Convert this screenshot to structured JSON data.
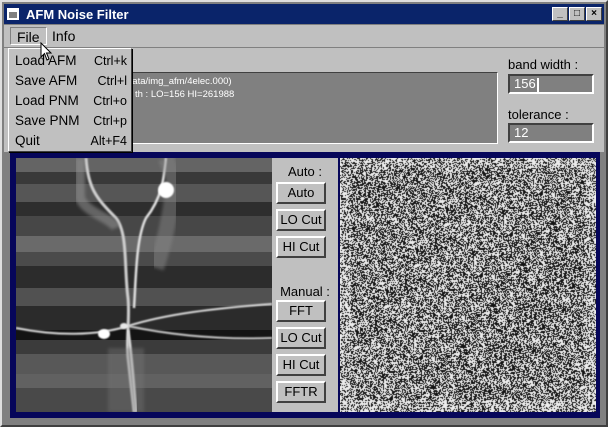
{
  "window": {
    "title": "AFM Noise Filter",
    "buttons": {
      "minimize": "_",
      "maximize": "□",
      "close": "×"
    }
  },
  "menubar": {
    "items": [
      "File",
      "Info"
    ]
  },
  "file_menu": {
    "items": [
      {
        "label": "Load AFM",
        "shortcut": "Ctrl+k"
      },
      {
        "label": "Save AFM",
        "shortcut": "Ctrl+l"
      },
      {
        "label": "Load PNM",
        "shortcut": "Ctrl+o"
      },
      {
        "label": "Save PNM",
        "shortcut": "Ctrl+p"
      },
      {
        "label": "Quit",
        "shortcut": "Alt+F4"
      }
    ]
  },
  "log": {
    "lines": [
      "data/img_afm/4elec.000)",
      "th : LO=156 HI=261988"
    ]
  },
  "bandwidth": {
    "label": "band width :",
    "value": "156"
  },
  "tolerance": {
    "label": "tolerance :",
    "value": "12"
  },
  "auto": {
    "label": "Auto :",
    "buttons": [
      "Auto",
      "LO Cut",
      "HI Cut"
    ]
  },
  "manual": {
    "label": "Manual :",
    "buttons": [
      "FFT",
      "LO Cut",
      "HI Cut",
      "FFTR"
    ]
  },
  "colors": {
    "title_bar": "#0a246a",
    "face": "#c0c0c0",
    "image_border": "#06065a"
  }
}
